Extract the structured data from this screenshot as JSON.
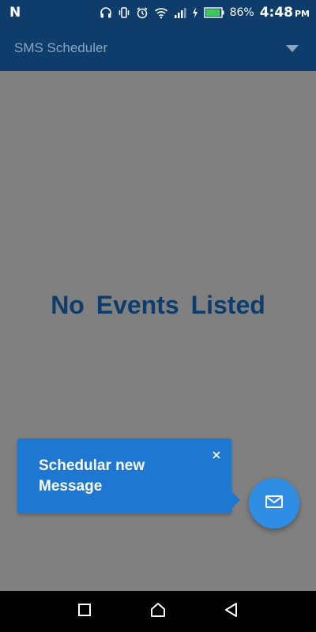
{
  "status_bar": {
    "notification_icon": "N",
    "battery_percent": "86%",
    "time": "4:48",
    "ampm": "PM",
    "icons": [
      "headset-icon",
      "vibrate-icon",
      "alarm-icon",
      "wifi-icon",
      "signal-icon",
      "charging-icon",
      "battery-icon"
    ]
  },
  "app_bar": {
    "title": "SMS Scheduler",
    "menu_icon": "dropdown-arrow-icon"
  },
  "main": {
    "empty_message": "No Events Listed"
  },
  "tooltip": {
    "text": "Schedular new Message",
    "close_icon": "close-icon"
  },
  "fab": {
    "icon": "mail-icon"
  },
  "nav_bar": {
    "icons": [
      "recents-icon",
      "home-icon",
      "back-icon"
    ]
  },
  "colors": {
    "primary_dark": "#0e3c6b",
    "title_text": "#8aa6c2",
    "background_dim": "#808080",
    "tooltip_blue": "#1e78d2",
    "fab_blue": "#2f8de4",
    "nav_bar": "#000000"
  }
}
